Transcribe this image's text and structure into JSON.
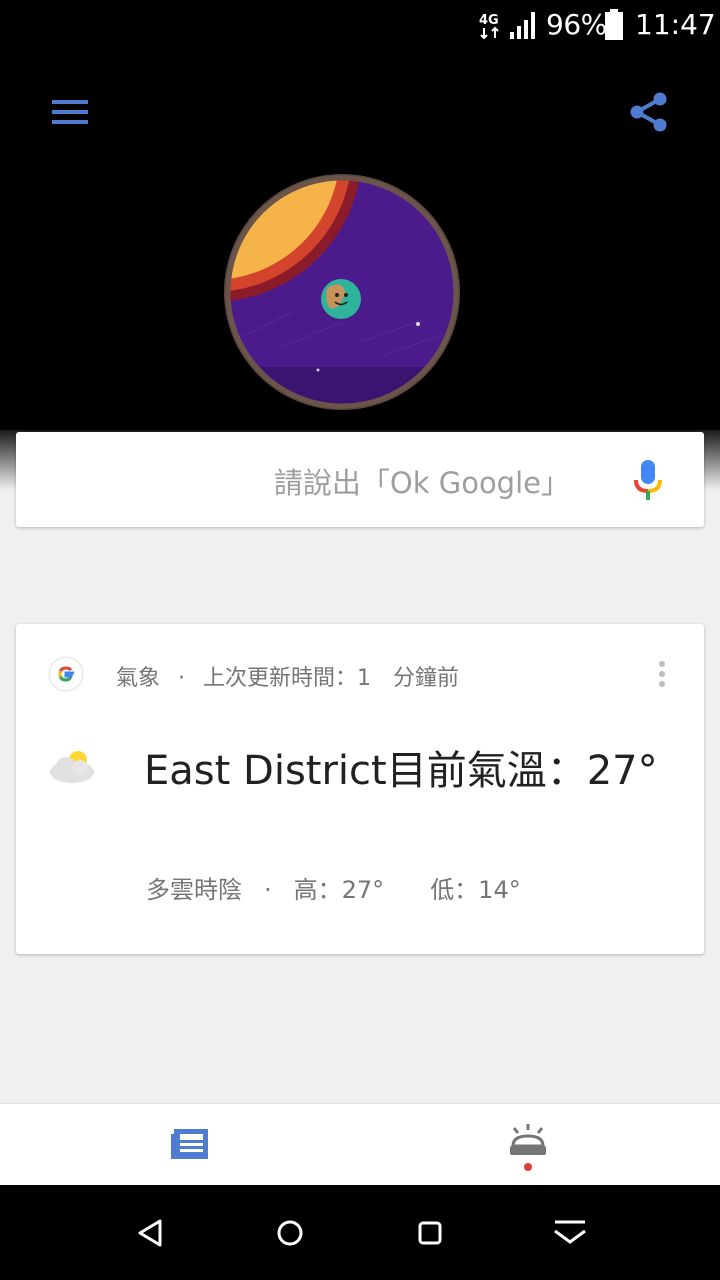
{
  "status_bar": {
    "network": "4G",
    "battery_percent": "96%",
    "time": "11:47",
    "icons": [
      "4g-icon",
      "signal-icon",
      "battery-icon"
    ]
  },
  "header": {
    "icons": [
      "menu-icon",
      "share-icon"
    ],
    "doodle": "google-doodle"
  },
  "search": {
    "placeholder": "請說出「Ok Google」",
    "icon": "mic-icon"
  },
  "weather_card": {
    "source": "氣象",
    "separator": "·",
    "updated": "上次更新時間：1　分鐘前",
    "title": "East District目前氣溫：27°",
    "condition": "多雲時陰",
    "high": "高：27°",
    "low": "低：14°",
    "icons": [
      "google-g-icon",
      "more-vert-icon",
      "partly-cloudy-icon"
    ]
  },
  "bottom_tabs": {
    "icons": [
      "feed-icon",
      "updates-icon"
    ],
    "active_color": "#4f7bd1"
  },
  "nav_bar": {
    "icons": [
      "back-icon",
      "home-icon",
      "recents-icon",
      "hide-nav-icon"
    ]
  }
}
